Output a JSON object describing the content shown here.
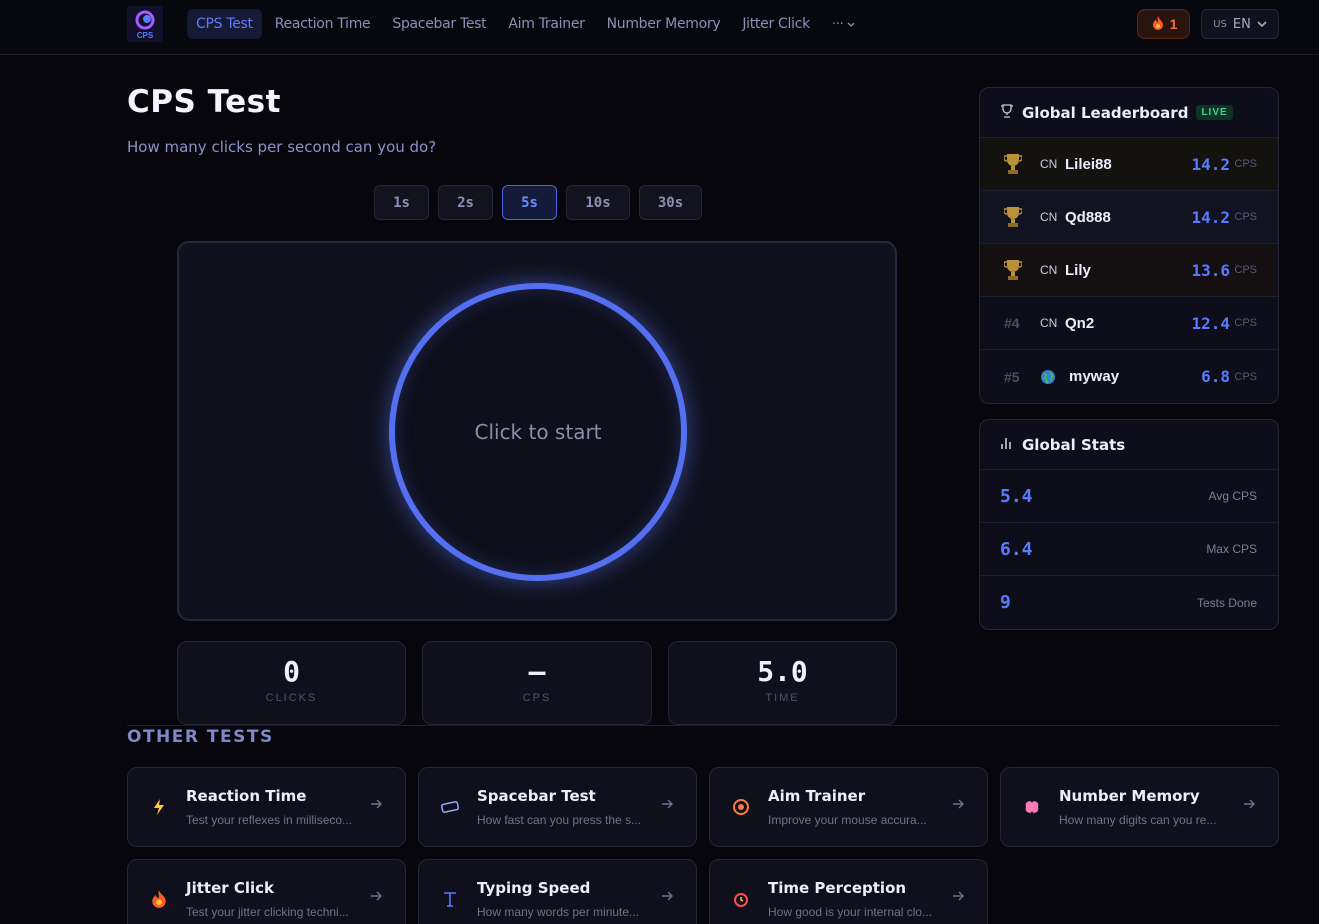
{
  "nav": {
    "logo_text": "CPS",
    "links": [
      {
        "label": "CPS Test",
        "active": true
      },
      {
        "label": "Reaction Time",
        "active": false
      },
      {
        "label": "Spacebar Test",
        "active": false
      },
      {
        "label": "Aim Trainer",
        "active": false
      },
      {
        "label": "Number Memory",
        "active": false
      },
      {
        "label": "Jitter Click",
        "active": false
      }
    ],
    "more_label": "···",
    "streak_count": "1",
    "lang_country": "US",
    "lang_code": "EN"
  },
  "main": {
    "title": "CPS Test",
    "subtitle": "How many clicks per second can you do?",
    "durations": [
      "1s",
      "2s",
      "5s",
      "10s",
      "30s"
    ],
    "selected_duration": "5s",
    "click_prompt": "Click to start",
    "stats": {
      "clicks_value": "0",
      "clicks_label": "CLICKS",
      "cps_value": "–",
      "cps_label": "CPS",
      "time_value": "5.0",
      "time_label": "TIME"
    }
  },
  "other_tests": {
    "heading": "OTHER TESTS",
    "cards": [
      {
        "title": "Reaction Time",
        "desc": "Test your reflexes in milliseco...",
        "icon": "lightning-icon",
        "color": "#ffcc33"
      },
      {
        "title": "Spacebar Test",
        "desc": "How fast can you press the s...",
        "icon": "keyboard-icon",
        "color": "#9aa3ff"
      },
      {
        "title": "Aim Trainer",
        "desc": "Improve your mouse accura...",
        "icon": "target-icon",
        "color": "#ff7a3d"
      },
      {
        "title": "Number Memory",
        "desc": "How many digits can you re...",
        "icon": "brain-icon",
        "color": "#ff7ab8"
      },
      {
        "title": "Jitter Click",
        "desc": "Test your jitter clicking techni...",
        "icon": "fire-icon",
        "color": "#ff5a2a"
      },
      {
        "title": "Typing Speed",
        "desc": "How many words per minute...",
        "icon": "text-icon",
        "color": "#5b7bff"
      },
      {
        "title": "Time Perception",
        "desc": "How good is your internal clo...",
        "icon": "alarm-clock-icon",
        "color": "#ff4a5a"
      }
    ]
  },
  "leaderboard": {
    "title": "Global Leaderboard",
    "live_label": "LIVE",
    "unit": "CPS",
    "rows": [
      {
        "rank": "",
        "trophy": true,
        "cc": "CN",
        "name": "Lilei88",
        "value": "14.2",
        "bg": "#14120f"
      },
      {
        "rank": "",
        "trophy": true,
        "cc": "CN",
        "name": "Qd888",
        "value": "14.2",
        "bg": "#111320"
      },
      {
        "rank": "",
        "trophy": true,
        "cc": "CN",
        "name": "Lily",
        "value": "13.6",
        "bg": "#141012"
      },
      {
        "rank": "#4",
        "trophy": false,
        "cc": "CN",
        "name": "Qn2",
        "value": "12.4",
        "bg": "#0d0e19"
      },
      {
        "rank": "#5",
        "trophy": false,
        "cc": "",
        "name": "myway",
        "value": "6.8",
        "bg": "#0d0e19"
      }
    ]
  },
  "global_stats": {
    "title": "Global Stats",
    "rows": [
      {
        "value": "5.4",
        "label": "Avg CPS"
      },
      {
        "value": "6.4",
        "label": "Max CPS"
      },
      {
        "value": "9",
        "label": "Tests Done"
      }
    ]
  },
  "colors": {
    "accent": "#5b7bff",
    "live": "#3fd58e",
    "streak": "#ff6a3d"
  }
}
